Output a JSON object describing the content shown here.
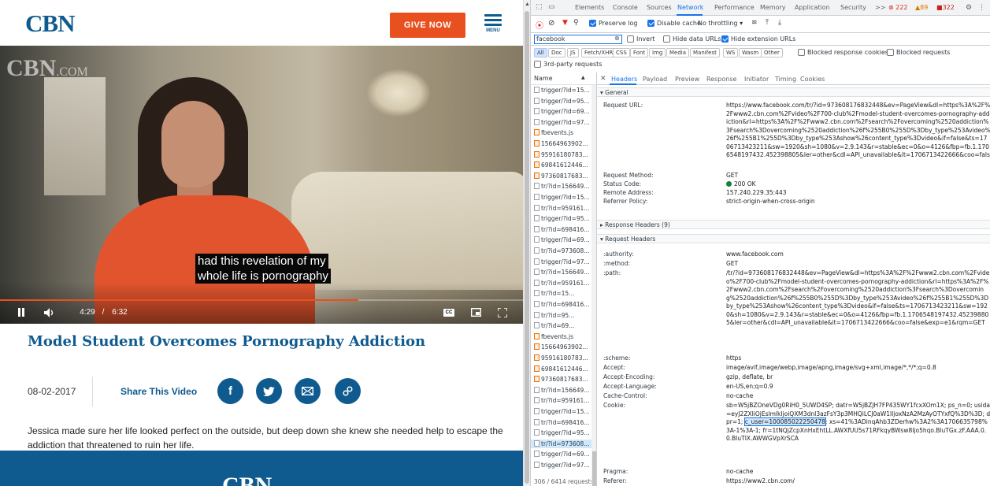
{
  "site": {
    "logo": "CBN",
    "give_now": "GIVE NOW",
    "menu_label": "MENU",
    "watermark": "CBN",
    "watermark_suffix": ".COM",
    "caption_line1": "had this revelation of my",
    "caption_line2": "whole life is pornography",
    "time_current": "4:29",
    "time_sep": "/",
    "time_total": "6:32",
    "progress_fraction": 0.685,
    "cc_label": "CC",
    "video_title": "Model Student Overcomes Pornography Addiction",
    "date": "08-02-2017",
    "share_label": "Share This Video",
    "description": "Jessica made sure her life looked perfect on the outside, but deep down she knew she needed help to escape the addiction that threatened to ruin her life.",
    "footer_logo": "CBN"
  },
  "devtools": {
    "tabs": [
      "Elements",
      "Console",
      "Sources",
      "Network",
      "Performance",
      "Memory",
      "Application",
      "Security"
    ],
    "active_tab": "Network",
    "more": ">>",
    "errors": "222",
    "warnings": "89",
    "issues": "322",
    "toolbar": {
      "preserve_log": "Preserve log",
      "disable_cache": "Disable cache",
      "throttling": "No throttling"
    },
    "filter": {
      "value": "facebook",
      "invert": "Invert",
      "hide_data_urls": "Hide data URLs",
      "hide_extension_urls": "Hide extension URLs"
    },
    "types": [
      "All",
      "Doc",
      "JS",
      "Fetch/XHR",
      "CSS",
      "Font",
      "Img",
      "Media",
      "Manifest",
      "WS",
      "Wasm",
      "Other"
    ],
    "blocked_cookies": "Blocked response cookies",
    "blocked_requests": "Blocked requests",
    "third_party": "3rd-party requests",
    "name_header": "Name",
    "requests": [
      "trigger/?id=15...",
      "trigger/?id=95...",
      "trigger/?id=69...",
      "trigger/?id=97...",
      "fbevents.js",
      "15664963902...",
      "95916180783...",
      "69841612446...",
      "97360817683...",
      "tr/?id=156649...",
      "trigger/?id=15...",
      "tr/?id=959161...",
      "trigger/?id=95...",
      "tr/?id=698416...",
      "trigger/?id=69...",
      "tr/?id=973608...",
      "trigger/?id=97...",
      "tr/?id=156649...",
      "tr/?id=959161...",
      "tr/?id=15...",
      "tr/?id=698416...",
      "tr/?id=95...",
      "tr/?id=69...",
      "fbevents.js",
      "15664963902...",
      "95916180783...",
      "69841612446...",
      "97360817683...",
      "tr/?id=156649...",
      "tr/?id=959161...",
      "trigger/?id=15...",
      "tr/?id=698416...",
      "trigger/?id=95...",
      "tr/?id=973608...",
      "trigger/?id=69...",
      "trigger/?id=97..."
    ],
    "selected_index": 33,
    "status_bar": "306 / 6414 requests",
    "detail_tabs": [
      "Headers",
      "Payload",
      "Preview",
      "Response",
      "Initiator",
      "Timing",
      "Cookies"
    ],
    "general_title": "General",
    "general": [
      {
        "k": "Request URL:",
        "v": "https://www.facebook.com/tr/?id=973608176832448&ev=PageView&dl=https%3A%2F%2Fwww2.cbn.com%2Fvideo%2F700-club%2Fmodel-student-overcomes-pornography-addiction&rl=https%3A%2F%2Fwww2.cbn.com%2Fsearch%2Fovercoming%2520addiction%3Fsearch%3Dovercoming%2520addiction%26f%255B0%255D%3Dby_type%253Avideo%26f%255B1%255D%3Dby_type%253Ashow%26content_type%3Dvideo&if=false&ts=1706713423211&sw=1920&sh=1080&v=2.9.143&r=stable&ec=0&o=4126&fbp=fb.1.1706548197432.452398805&ler=other&cdl=API_unavailable&it=1706713422666&coo=false&exp=e1&rqm=GET"
      },
      {
        "k": "Request Method:",
        "v": "GET"
      },
      {
        "k": "Status Code:",
        "v": "200 OK"
      },
      {
        "k": "Remote Address:",
        "v": "157.240.229.35:443"
      },
      {
        "k": "Referrer Policy:",
        "v": "strict-origin-when-cross-origin"
      }
    ],
    "response_headers_title": "Response Headers (9)",
    "request_headers_title": "Request Headers",
    "request_headers": [
      {
        "k": ":authority:",
        "v": "www.facebook.com"
      },
      {
        "k": ":method:",
        "v": "GET"
      },
      {
        "k": ":path:",
        "v": "/tr/?id=973608176832448&ev=PageView&dl=https%3A%2F%2Fwww2.cbn.com%2Fvideo%2F700-club%2Fmodel-student-overcomes-pornography-addiction&rl=https%3A%2F%2Fwww2.cbn.com%2Fsearch%2Fovercoming%2520addiction%3Fsearch%3Dovercoming%2520addiction%26f%255B0%255D%3Dby_type%253Avideo%26f%255B1%255D%3Dby_type%253Ashow%26content_type%3Dvideo&if=false&ts=1706713423211&sw=1920&sh=1080&v=2.9.143&r=stable&ec=0&o=4126&fbp=fb.1.1706548197432.452398805&ler=other&cdl=API_unavailable&it=1706713422666&coo=false&exp=e1&rqm=GET"
      },
      {
        "k": ":scheme:",
        "v": "https"
      },
      {
        "k": "Accept:",
        "v": "image/avif,image/webp,image/apng,image/svg+xml,image/*,*/*;q=0.8"
      },
      {
        "k": "Accept-Encoding:",
        "v": "gzip, deflate, br"
      },
      {
        "k": "Accept-Language:",
        "v": "en-US,en;q=0.9"
      },
      {
        "k": "Cache-Control:",
        "v": "no-cache"
      }
    ],
    "cookie_key": "Cookie:",
    "cookie_before": "sb=W5jBZOneVDg0RiH0_5UWD4SP; datr=W5jBZJH7FP435WY1fcxXOm1X; ps_n=0; usida=eyJ2ZXIiOjEslmlkIjoiQXM3dnI3azFsY3p3MHQiLCJ0aW1lIjoxNzA2MzAyOTYxfQ%3D%3D; dpr=1; ",
    "cookie_highlight": "c_user=100085022250478",
    "cookie_after": "; xs=41%3ADinqAhb3ZDerhw%3A2%3A1706635798%3A-1%3A-1; fr=1tNQjZcpXnHxEhtLL.AWXfUU5s71RFkqyBWsw8Ijo5hqo.BluTGx.zF.AAA.0.0.BluTIX.AWWGVpXrSCA",
    "pragma": {
      "k": "Pragma:",
      "v": "no-cache"
    },
    "referer": {
      "k": "Referer:",
      "v": "https://www2.cbn.com/"
    }
  },
  "colors": {
    "brand_blue": "#0f5a8f",
    "give_orange": "#e8501f",
    "devtools_blue": "#1a73e8"
  }
}
